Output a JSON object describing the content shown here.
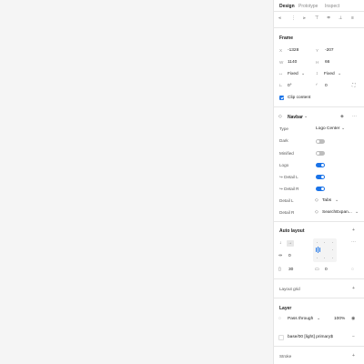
{
  "tabs": [
    "Design",
    "Prototype",
    "Inspect"
  ],
  "frame": {
    "title": "Frame",
    "x_label": "X",
    "x": "-1328",
    "y_label": "Y",
    "y": "-207",
    "w_label": "W",
    "w": "1140",
    "h_label": "H",
    "h": "66",
    "w_sizing": "Fixed",
    "h_sizing": "Fixed",
    "rotation": "0°",
    "radius": "0",
    "clip_content": "Clip content"
  },
  "component": {
    "name": "Navbar",
    "props": [
      {
        "label": "Type",
        "value": "Logo Center"
      },
      {
        "label": "Dark",
        "value": "off"
      },
      {
        "label": "Minified",
        "value": "off"
      },
      {
        "label": "Logo",
        "value": "on"
      },
      {
        "label": "↪ Detail L",
        "value": "on"
      },
      {
        "label": "↪ Detail R",
        "value": "on"
      },
      {
        "label": "Detail L",
        "value": "Tabs"
      },
      {
        "label": "Detail R",
        "value": "SearchExpan..."
      }
    ]
  },
  "auto_layout": {
    "title": "Auto layout",
    "spacing": "0",
    "padding_h": "30",
    "padding_v": "0"
  },
  "layout_grid": {
    "title": "Layout grid"
  },
  "layer": {
    "title": "Layer",
    "blend": "Pass through",
    "opacity": "100%",
    "style": "base/00 [light] primary$"
  },
  "stroke": {
    "title": "Stroke"
  },
  "colors": {
    "accent": "#1a73e8",
    "canvas": "#f5f5f5",
    "panel": "#ffffff"
  }
}
